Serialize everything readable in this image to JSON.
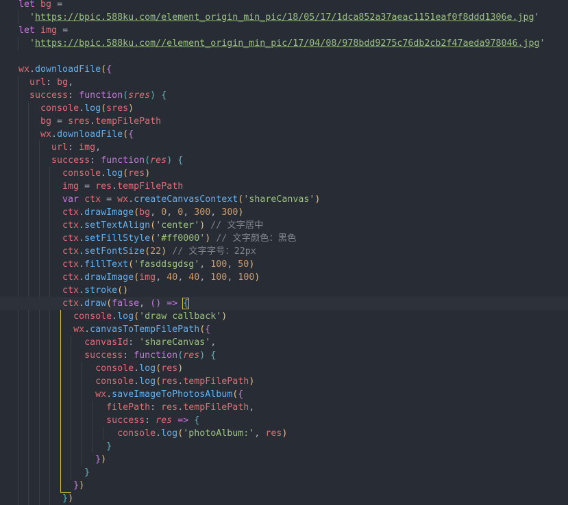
{
  "code_lines": [
    [
      [
        "kw",
        "let"
      ],
      [
        "p",
        " "
      ],
      [
        "var",
        "bg"
      ],
      [
        "p",
        " ="
      ]
    ],
    [
      [
        "p",
        "  "
      ],
      [
        "str",
        "'"
      ],
      [
        "strlink",
        "https://bpic.588ku.com/element_origin_min_pic/18/05/17/1dca852a37aeac1151eaf0f8ddd1306e.jpg"
      ],
      [
        "str",
        "'"
      ]
    ],
    [
      [
        "kw",
        "let"
      ],
      [
        "p",
        " "
      ],
      [
        "var",
        "img"
      ],
      [
        "p",
        " ="
      ]
    ],
    [
      [
        "p",
        "  "
      ],
      [
        "str",
        "'"
      ],
      [
        "strlink",
        "https://bpic.588ku.com//element_origin_min_pic/17/04/08/978bdd9275c76db2cb2f47aeda978046.jpg"
      ],
      [
        "str",
        "'"
      ]
    ],
    [],
    [
      [
        "var",
        "wx"
      ],
      [
        "p",
        "."
      ],
      [
        "fn",
        "downloadFile"
      ],
      [
        "paren",
        "("
      ],
      [
        "paren-m",
        "{"
      ]
    ],
    [
      [
        "p",
        "  "
      ],
      [
        "var",
        "url"
      ],
      [
        "p",
        ": "
      ],
      [
        "var",
        "bg"
      ],
      [
        "p",
        ","
      ]
    ],
    [
      [
        "p",
        "  "
      ],
      [
        "var",
        "success"
      ],
      [
        "p",
        ": "
      ],
      [
        "kw",
        "function"
      ],
      [
        "paren-b",
        "("
      ],
      [
        "param",
        "sres"
      ],
      [
        "paren-b",
        ")"
      ],
      [
        "p",
        " "
      ],
      [
        "paren-b",
        "{"
      ]
    ],
    [
      [
        "p",
        "    "
      ],
      [
        "var",
        "console"
      ],
      [
        "p",
        "."
      ],
      [
        "fn",
        "log"
      ],
      [
        "paren",
        "("
      ],
      [
        "var",
        "sres"
      ],
      [
        "paren",
        ")"
      ]
    ],
    [
      [
        "p",
        "    "
      ],
      [
        "var",
        "bg"
      ],
      [
        "p",
        " = "
      ],
      [
        "var",
        "sres"
      ],
      [
        "p",
        "."
      ],
      [
        "var",
        "tempFilePath"
      ]
    ],
    [
      [
        "p",
        "    "
      ],
      [
        "var",
        "wx"
      ],
      [
        "p",
        "."
      ],
      [
        "fn",
        "downloadFile"
      ],
      [
        "paren",
        "("
      ],
      [
        "paren-m",
        "{"
      ]
    ],
    [
      [
        "p",
        "      "
      ],
      [
        "var",
        "url"
      ],
      [
        "p",
        ": "
      ],
      [
        "var",
        "img"
      ],
      [
        "p",
        ","
      ]
    ],
    [
      [
        "p",
        "      "
      ],
      [
        "var",
        "success"
      ],
      [
        "p",
        ": "
      ],
      [
        "kw",
        "function"
      ],
      [
        "paren-b",
        "("
      ],
      [
        "param",
        "res"
      ],
      [
        "paren-b",
        ")"
      ],
      [
        "p",
        " "
      ],
      [
        "paren-b",
        "{"
      ]
    ],
    [
      [
        "p",
        "        "
      ],
      [
        "var",
        "console"
      ],
      [
        "p",
        "."
      ],
      [
        "fn",
        "log"
      ],
      [
        "paren",
        "("
      ],
      [
        "var",
        "res"
      ],
      [
        "paren",
        ")"
      ]
    ],
    [
      [
        "p",
        "        "
      ],
      [
        "var",
        "img"
      ],
      [
        "p",
        " = "
      ],
      [
        "var",
        "res"
      ],
      [
        "p",
        "."
      ],
      [
        "var",
        "tempFilePath"
      ]
    ],
    [
      [
        "p",
        "        "
      ],
      [
        "kw",
        "var"
      ],
      [
        "p",
        " "
      ],
      [
        "var",
        "ctx"
      ],
      [
        "p",
        " = "
      ],
      [
        "var",
        "wx"
      ],
      [
        "p",
        "."
      ],
      [
        "fn",
        "createCanvasContext"
      ],
      [
        "paren",
        "("
      ],
      [
        "str",
        "'shareCanvas'"
      ],
      [
        "paren",
        ")"
      ]
    ],
    [
      [
        "p",
        "        "
      ],
      [
        "var",
        "ctx"
      ],
      [
        "p",
        "."
      ],
      [
        "fn",
        "drawImage"
      ],
      [
        "paren",
        "("
      ],
      [
        "var",
        "bg"
      ],
      [
        "p",
        ", "
      ],
      [
        "num",
        "0"
      ],
      [
        "p",
        ", "
      ],
      [
        "num",
        "0"
      ],
      [
        "p",
        ", "
      ],
      [
        "num",
        "300"
      ],
      [
        "p",
        ", "
      ],
      [
        "num",
        "300"
      ],
      [
        "paren",
        ")"
      ]
    ],
    [
      [
        "p",
        "        "
      ],
      [
        "var",
        "ctx"
      ],
      [
        "p",
        "."
      ],
      [
        "fn",
        "setTextAlign"
      ],
      [
        "paren",
        "("
      ],
      [
        "str",
        "'center'"
      ],
      [
        "paren",
        ")"
      ],
      [
        "p",
        " "
      ],
      [
        "cmt",
        "// 文字居中"
      ]
    ],
    [
      [
        "p",
        "        "
      ],
      [
        "var",
        "ctx"
      ],
      [
        "p",
        "."
      ],
      [
        "fn",
        "setFillStyle"
      ],
      [
        "paren",
        "("
      ],
      [
        "str",
        "'#ff0000'"
      ],
      [
        "paren",
        ")"
      ],
      [
        "p",
        " "
      ],
      [
        "cmt",
        "// 文字颜色：黑色"
      ]
    ],
    [
      [
        "p",
        "        "
      ],
      [
        "var",
        "ctx"
      ],
      [
        "p",
        "."
      ],
      [
        "fn",
        "setFontSize"
      ],
      [
        "paren",
        "("
      ],
      [
        "num",
        "22"
      ],
      [
        "paren",
        ")"
      ],
      [
        "p",
        " "
      ],
      [
        "cmt",
        "// 文字字号：22px"
      ]
    ],
    [
      [
        "p",
        "        "
      ],
      [
        "var",
        "ctx"
      ],
      [
        "p",
        "."
      ],
      [
        "fn",
        "fillText"
      ],
      [
        "paren",
        "("
      ],
      [
        "str",
        "'fasddsgdsg'"
      ],
      [
        "p",
        ", "
      ],
      [
        "num",
        "100"
      ],
      [
        "p",
        ", "
      ],
      [
        "num",
        "50"
      ],
      [
        "paren",
        ")"
      ]
    ],
    [
      [
        "p",
        "        "
      ],
      [
        "var",
        "ctx"
      ],
      [
        "p",
        "."
      ],
      [
        "fn",
        "drawImage"
      ],
      [
        "paren",
        "("
      ],
      [
        "var",
        "img"
      ],
      [
        "p",
        ", "
      ],
      [
        "num",
        "40"
      ],
      [
        "p",
        ", "
      ],
      [
        "num",
        "40"
      ],
      [
        "p",
        ", "
      ],
      [
        "num",
        "100"
      ],
      [
        "p",
        ", "
      ],
      [
        "num",
        "100"
      ],
      [
        "paren",
        ")"
      ]
    ],
    [
      [
        "p",
        "        "
      ],
      [
        "var",
        "ctx"
      ],
      [
        "p",
        "."
      ],
      [
        "fn",
        "stroke"
      ],
      [
        "paren",
        "()"
      ]
    ],
    [
      [
        "p",
        "        "
      ],
      [
        "var",
        "ctx"
      ],
      [
        "p",
        "."
      ],
      [
        "fn",
        "draw"
      ],
      [
        "paren",
        "("
      ],
      [
        "kw",
        "false"
      ],
      [
        "p",
        ", "
      ],
      [
        "paren-m",
        "()"
      ],
      [
        "p",
        " "
      ],
      [
        "kw",
        "=>"
      ],
      [
        "p",
        " "
      ],
      [
        "paren-b-hl",
        "{"
      ]
    ],
    [
      [
        "p",
        "          "
      ],
      [
        "var",
        "console"
      ],
      [
        "p",
        "."
      ],
      [
        "fn",
        "log"
      ],
      [
        "paren",
        "("
      ],
      [
        "str",
        "'draw callback'"
      ],
      [
        "paren",
        ")"
      ]
    ],
    [
      [
        "p",
        "          "
      ],
      [
        "var",
        "wx"
      ],
      [
        "p",
        "."
      ],
      [
        "fn",
        "canvasToTempFilePath"
      ],
      [
        "paren",
        "("
      ],
      [
        "paren-m",
        "{"
      ]
    ],
    [
      [
        "p",
        "            "
      ],
      [
        "var",
        "canvasId"
      ],
      [
        "p",
        ": "
      ],
      [
        "str",
        "'shareCanvas'"
      ],
      [
        "p",
        ","
      ]
    ],
    [
      [
        "p",
        "            "
      ],
      [
        "var",
        "success"
      ],
      [
        "p",
        ": "
      ],
      [
        "kw",
        "function"
      ],
      [
        "paren-b",
        "("
      ],
      [
        "param",
        "res"
      ],
      [
        "paren-b",
        ")"
      ],
      [
        "p",
        " "
      ],
      [
        "paren-b",
        "{"
      ]
    ],
    [
      [
        "p",
        "              "
      ],
      [
        "var",
        "console"
      ],
      [
        "p",
        "."
      ],
      [
        "fn",
        "log"
      ],
      [
        "paren",
        "("
      ],
      [
        "var",
        "res"
      ],
      [
        "paren",
        ")"
      ]
    ],
    [
      [
        "p",
        "              "
      ],
      [
        "var",
        "console"
      ],
      [
        "p",
        "."
      ],
      [
        "fn",
        "log"
      ],
      [
        "paren",
        "("
      ],
      [
        "var",
        "res"
      ],
      [
        "p",
        "."
      ],
      [
        "var",
        "tempFilePath"
      ],
      [
        "paren",
        ")"
      ]
    ],
    [
      [
        "p",
        "              "
      ],
      [
        "var",
        "wx"
      ],
      [
        "p",
        "."
      ],
      [
        "fn",
        "saveImageToPhotosAlbum"
      ],
      [
        "paren",
        "("
      ],
      [
        "paren-m",
        "{"
      ]
    ],
    [
      [
        "p",
        "                "
      ],
      [
        "var",
        "filePath"
      ],
      [
        "p",
        ": "
      ],
      [
        "var",
        "res"
      ],
      [
        "p",
        "."
      ],
      [
        "var",
        "tempFilePath"
      ],
      [
        "p",
        ","
      ]
    ],
    [
      [
        "p",
        "                "
      ],
      [
        "var",
        "success"
      ],
      [
        "p",
        ": "
      ],
      [
        "param",
        "res"
      ],
      [
        "p",
        " "
      ],
      [
        "kw",
        "=>"
      ],
      [
        "p",
        " "
      ],
      [
        "paren-b",
        "{"
      ]
    ],
    [
      [
        "p",
        "                  "
      ],
      [
        "var",
        "console"
      ],
      [
        "p",
        "."
      ],
      [
        "fn",
        "log"
      ],
      [
        "paren",
        "("
      ],
      [
        "str",
        "'photoAlbum:'"
      ],
      [
        "p",
        ", "
      ],
      [
        "var",
        "res"
      ],
      [
        "paren",
        ")"
      ]
    ],
    [
      [
        "p",
        "                "
      ],
      [
        "paren-b",
        "}"
      ]
    ],
    [
      [
        "p",
        "              "
      ],
      [
        "paren-m",
        "}"
      ],
      [
        "paren",
        ")"
      ]
    ],
    [
      [
        "p",
        "            "
      ],
      [
        "paren-b",
        "}"
      ]
    ],
    [
      [
        "p",
        "          "
      ],
      [
        "paren-m",
        "}"
      ],
      [
        "paren",
        ")"
      ]
    ],
    [
      [
        "p",
        "        "
      ],
      [
        "paren-b",
        "}"
      ],
      [
        "paren",
        ")"
      ]
    ]
  ]
}
